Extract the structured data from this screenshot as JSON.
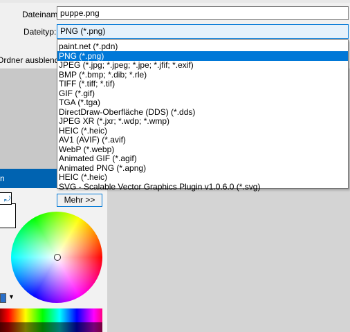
{
  "dialog": {
    "filename_label": "Dateiname:",
    "filename_value": "puppe.png",
    "filetype_label": "Dateityp:",
    "filetype_value": "PNG (*.png)",
    "hide_folders_label": "Ordner ausblende",
    "more_button": "Mehr >>"
  },
  "filetype_options": [
    "paint.net (*.pdn)",
    "PNG (*.png)",
    "JPEG (*.jpg; *.jpeg; *.jpe; *.jfif; *.exif)",
    "BMP (*.bmp; *.dib; *.rle)",
    "TIFF (*.tiff; *.tif)",
    "GIF (*.gif)",
    "TGA (*.tga)",
    "DirectDraw-Oberfläche (DDS) (*.dds)",
    "JPEG XR (*.jxr; *.wdp; *.wmp)",
    "HEIC (*.heic)",
    "AV1 (AVIF) (*.avif)",
    "WebP (*.webp)",
    "Animated GIF (*.agif)",
    "Animated PNG (*.apng)",
    "HEIC (*.heic)",
    "SVG - Scalable Vector Graphics Plugin v1.0.6.0 (*.svg)"
  ],
  "selected_filetype": "PNG (*.png)",
  "colors_window": {
    "title": "n"
  },
  "colors": {
    "accent": "#0078d7",
    "titlebar": "#0063b1",
    "background": "#d4d4d4"
  }
}
